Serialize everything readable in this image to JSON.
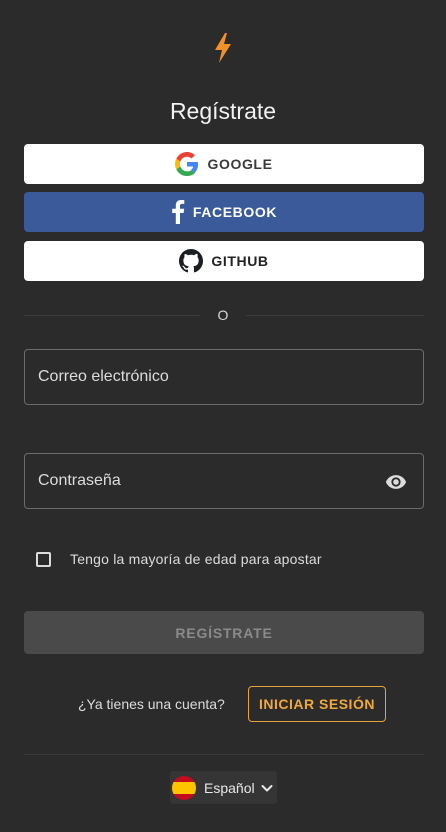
{
  "page": {
    "title": "Regístrate"
  },
  "social": {
    "google_label": "GOOGLE",
    "facebook_label": "FACEBOOK",
    "github_label": "GITHUB"
  },
  "divider": {
    "label": "O"
  },
  "form": {
    "email_placeholder": "Correo electrónico",
    "email_value": "",
    "password_placeholder": "Contraseña",
    "password_value": "",
    "age_checkbox_label": "Tengo la mayoría de edad para apostar",
    "age_checked": false,
    "submit_label": "REGÍSTRATE"
  },
  "login": {
    "question": "¿Ya tienes una cuenta?",
    "button_label": "INICIAR SESIÓN"
  },
  "language": {
    "selected": "Español"
  },
  "colors": {
    "background": "#2b2b2b",
    "accent": "#f0a93a",
    "facebook": "#3b5a9a",
    "disabled": "#4a4a4a"
  },
  "icons": {
    "logo": "lightning-bolt-icon",
    "google": "google-icon",
    "facebook": "facebook-icon",
    "github": "github-icon",
    "password_toggle": "eye-icon",
    "flag": "spain-flag-icon",
    "dropdown": "chevron-down-icon"
  }
}
